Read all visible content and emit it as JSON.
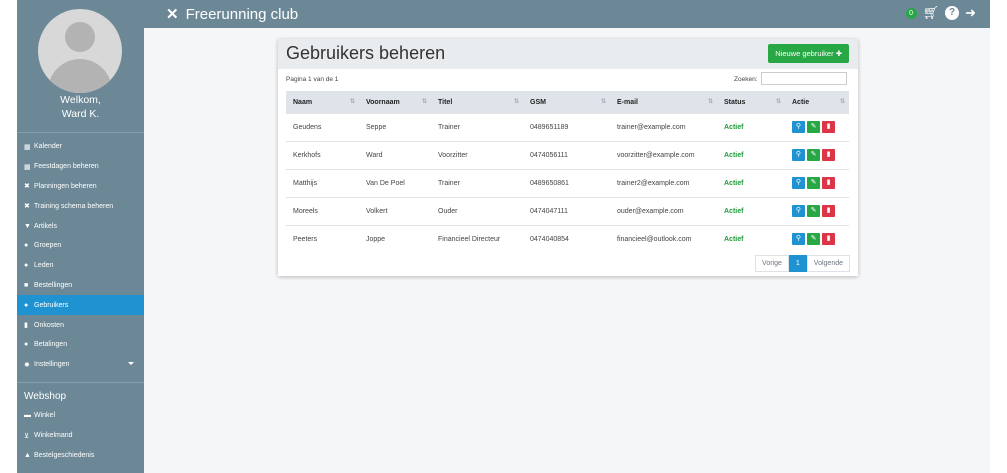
{
  "app": {
    "title": "Freerunning club",
    "cart_count": "0"
  },
  "user": {
    "welcome": "Welkom,",
    "name": "Ward K."
  },
  "sidebar": {
    "items": [
      {
        "label": "Kalender",
        "icon": "calendar-icon"
      },
      {
        "label": "Feestdagen beheren",
        "icon": "calendar-icon"
      },
      {
        "label": "Planningen beheren",
        "icon": "tools-icon"
      },
      {
        "label": "Training schema beheren",
        "icon": "tools-icon"
      },
      {
        "label": "Artikels",
        "icon": "shirt-icon"
      },
      {
        "label": "Groepen",
        "icon": "users-icon"
      },
      {
        "label": "Leden",
        "icon": "users-icon"
      },
      {
        "label": "Bestellingen",
        "icon": "truck-icon"
      },
      {
        "label": "Gebruikers",
        "icon": "users-icon",
        "active": true
      },
      {
        "label": "Onkosten",
        "icon": "file-icon"
      },
      {
        "label": "Betalingen",
        "icon": "money-icon"
      },
      {
        "label": "Instellingen",
        "icon": "gears-icon"
      }
    ],
    "webshop_title": "Webshop",
    "webshop_items": [
      {
        "label": "Winkel",
        "icon": "store-icon"
      },
      {
        "label": "Winkelmand",
        "icon": "cart-icon"
      },
      {
        "label": "Bestelgeschiedenis",
        "icon": "bag-icon"
      }
    ]
  },
  "page": {
    "title": "Gebruikers beheren",
    "new_button": "Nieuwe gebruiker",
    "page_info": "Pagina 1 van de 1",
    "search_label": "Zoeken:",
    "search_value": ""
  },
  "table": {
    "columns": [
      "Naam",
      "Voornaam",
      "Titel",
      "GSM",
      "E-mail",
      "Status",
      "Actie"
    ],
    "rows": [
      [
        "Geudens",
        "Seppe",
        "Trainer",
        "0489651189",
        "trainer@example.com",
        "Actief"
      ],
      [
        "Kerkhofs",
        "Ward",
        "Voorzitter",
        "0474056111",
        "voorzitter@example.com",
        "Actief"
      ],
      [
        "Matthijs",
        "Van De Poel",
        "Trainer",
        "0489650861",
        "trainer2@example.com",
        "Actief"
      ],
      [
        "Moreels",
        "Volkert",
        "Ouder",
        "0474047111",
        "ouder@example.com",
        "Actief"
      ],
      [
        "Peeters",
        "Joppe",
        "Financieel Directeur",
        "0474040854",
        "financieel@outlook.com",
        "Actief"
      ]
    ]
  },
  "pagination": {
    "prev": "Vorige",
    "current": "1",
    "next": "Volgende"
  }
}
